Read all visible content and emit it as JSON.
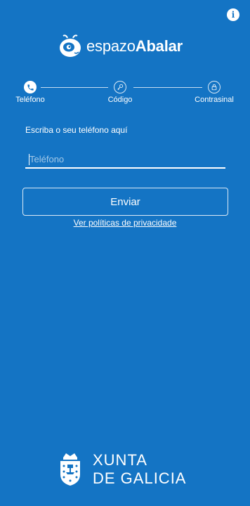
{
  "header": {
    "info_icon": "info-icon",
    "info_glyph": "i"
  },
  "logo": {
    "text_regular": "espazo",
    "text_bold": "Abalar",
    "icon": "abalar-mascot-icon"
  },
  "steps": [
    {
      "label": "Teléfono",
      "icon": "phone-icon",
      "state": "active"
    },
    {
      "label": "Código",
      "icon": "key-icon",
      "state": "inactive"
    },
    {
      "label": "Contrasinal",
      "icon": "lock-icon",
      "state": "inactive"
    }
  ],
  "form": {
    "prompt": "Escriba o seu teléfono aquí",
    "phone_placeholder": "Teléfono",
    "phone_value": "",
    "send_label": "Enviar",
    "privacy_link": "Ver políticas de privacidade"
  },
  "footer": {
    "line1": "XUNTA",
    "line2": "DE GALICIA",
    "icon": "xunta-crest-icon"
  },
  "colors": {
    "background": "#1474c4",
    "foreground": "#ffffff"
  }
}
